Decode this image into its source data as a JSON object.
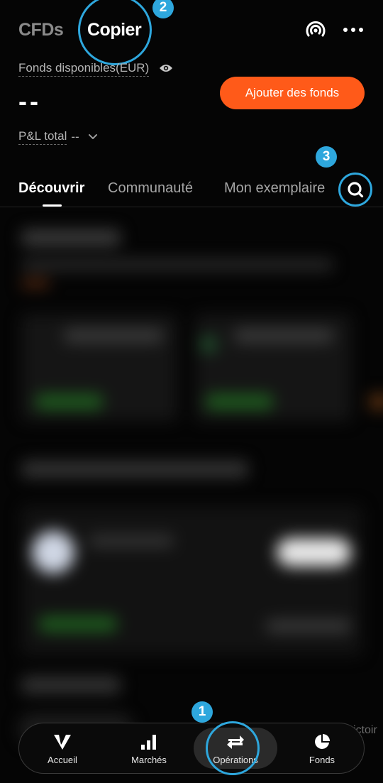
{
  "header": {
    "modes": [
      "CFDs",
      "Copier"
    ],
    "active_mode": "Copier",
    "icons": [
      "live-broadcast-icon",
      "more-icon"
    ]
  },
  "account": {
    "funds_label": "Fonds disponibles(EUR)",
    "funds_value": "--",
    "add_funds_label": "Ajouter des fonds",
    "pnl_label": "P&L total",
    "pnl_value": "--"
  },
  "tabs": {
    "items": [
      "Découvrir",
      "Communauté",
      "Mon exemplaire"
    ],
    "active": "Découvrir"
  },
  "nav": {
    "items": [
      {
        "label": "Accueil",
        "icon": "home-logo-icon"
      },
      {
        "label": "Marchés",
        "icon": "bar-chart-icon"
      },
      {
        "label": "Opérations",
        "icon": "swap-arrows-icon"
      },
      {
        "label": "Fonds",
        "icon": "pie-chart-icon"
      }
    ],
    "active": "Opérations"
  },
  "overlay_peek_text": "ictoir",
  "annotations": {
    "markers": [
      "1",
      "2",
      "3"
    ],
    "color": "#2ea7dd"
  },
  "colors": {
    "background": "#050505",
    "accent": "#ff5a19",
    "marker": "#2ea7dd"
  }
}
